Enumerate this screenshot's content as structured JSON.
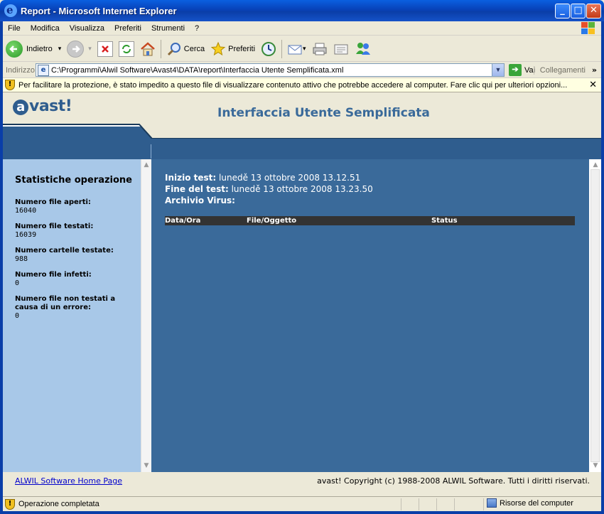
{
  "window": {
    "title": "Report - Microsoft Internet Explorer",
    "minimize": "_",
    "maximize": "□",
    "close": "✕"
  },
  "menubar": {
    "items": [
      "File",
      "Modifica",
      "Visualizza",
      "Preferiti",
      "Strumenti",
      "?"
    ]
  },
  "toolbar": {
    "back_label": "Indietro",
    "search_label": "Cerca",
    "favorites_label": "Preferiti",
    "dropdown_arrow": "▾"
  },
  "addressbar": {
    "label": "Indirizzo",
    "url": "C:\\Programmi\\Alwil Software\\Avast4\\DATA\\report\\Interfaccia Utente Semplificata.xml",
    "go_label": "Vai",
    "links_label": "Collegamenti",
    "more": "»"
  },
  "infobar": {
    "text": "Per facilitare la protezione, è stato impedito a questo file di visualizzare contenuto attivo che potrebbe accedere al computer. Fare clic qui per ulteriori opzioni...",
    "close": "✕"
  },
  "page": {
    "logo_text": "vast!",
    "logo_a": "a",
    "title": "Interfaccia Utente Semplificata",
    "sidebar": {
      "title": "Statistiche operazione",
      "stats": [
        {
          "label": "Numero file aperti:",
          "value": "16040"
        },
        {
          "label": "Numero file testati:",
          "value": "16039"
        },
        {
          "label": "Numero cartelle testate:",
          "value": "988"
        },
        {
          "label": "Numero file infetti:",
          "value": "0"
        },
        {
          "label": "Numero file non testati a causa di un errore:",
          "value": "0"
        }
      ]
    },
    "main": {
      "start_label": "Inizio test:",
      "start_value": " lunedě 13 ottobre 2008 13.12.51",
      "end_label": "Fine del test:",
      "end_value": " lunedě 13 ottobre 2008 13.23.50",
      "archive_label": "Archivio Virus:",
      "table_headers": [
        "Data/Ora",
        "File/Oggetto",
        "Status"
      ]
    },
    "footer": {
      "link": "ALWIL Software Home Page",
      "copyright": "avast! Copyright (c) 1988-2008 ALWIL Software. Tutti i diritti riservati."
    }
  },
  "statusbar": {
    "status": "Operazione completata",
    "zone": "Risorse del computer"
  },
  "colors": {
    "brand_blue": "#2f5d8e",
    "main_panel": "#3a6a9a",
    "sidebar": "#a8c8e8",
    "title_blue": "#3a6a9a"
  }
}
